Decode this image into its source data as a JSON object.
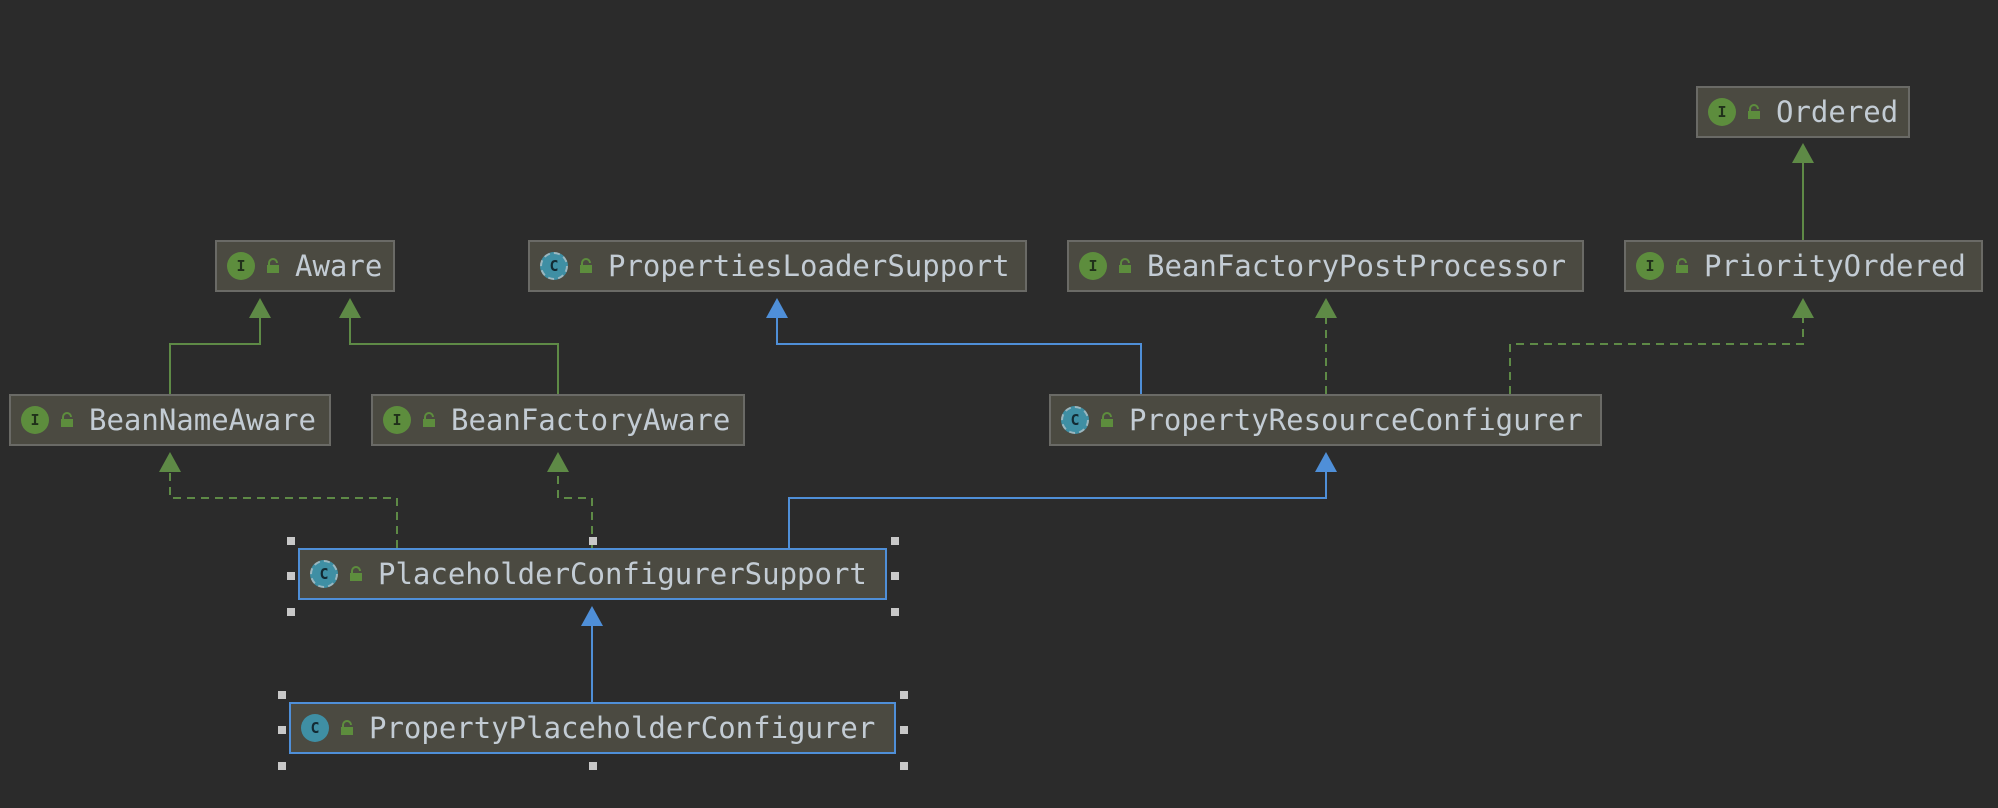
{
  "diagram": {
    "nodes": {
      "ordered": {
        "label": "Ordered",
        "kind": "interface"
      },
      "aware": {
        "label": "Aware",
        "kind": "interface"
      },
      "properties_loader_support": {
        "label": "PropertiesLoaderSupport",
        "kind": "abstract-class"
      },
      "bean_factory_post_processor": {
        "label": "BeanFactoryPostProcessor",
        "kind": "interface"
      },
      "priority_ordered": {
        "label": "PriorityOrdered",
        "kind": "interface"
      },
      "bean_name_aware": {
        "label": "BeanNameAware",
        "kind": "interface"
      },
      "bean_factory_aware": {
        "label": "BeanFactoryAware",
        "kind": "interface"
      },
      "property_resource_configurer": {
        "label": "PropertyResourceConfigurer",
        "kind": "abstract-class"
      },
      "placeholder_configurer_support": {
        "label": "PlaceholderConfigurerSupport",
        "kind": "abstract-class",
        "selected": true
      },
      "property_placeholder_configurer": {
        "label": "PropertyPlaceholderConfigurer",
        "kind": "class",
        "selected": true
      }
    },
    "kind_letters": {
      "interface": "I",
      "class": "C",
      "abstract-class": "C"
    },
    "edges": [
      {
        "from": "priority_ordered",
        "to": "ordered",
        "type": "extends-interface"
      },
      {
        "from": "bean_name_aware",
        "to": "aware",
        "type": "extends-interface"
      },
      {
        "from": "bean_factory_aware",
        "to": "aware",
        "type": "extends-interface"
      },
      {
        "from": "property_resource_configurer",
        "to": "properties_loader_support",
        "type": "extends-class"
      },
      {
        "from": "property_resource_configurer",
        "to": "bean_factory_post_processor",
        "type": "implements"
      },
      {
        "from": "property_resource_configurer",
        "to": "priority_ordered",
        "type": "implements"
      },
      {
        "from": "placeholder_configurer_support",
        "to": "bean_name_aware",
        "type": "implements"
      },
      {
        "from": "placeholder_configurer_support",
        "to": "bean_factory_aware",
        "type": "implements"
      },
      {
        "from": "placeholder_configurer_support",
        "to": "property_resource_configurer",
        "type": "extends-class"
      },
      {
        "from": "property_placeholder_configurer",
        "to": "placeholder_configurer_support",
        "type": "extends-class"
      }
    ],
    "colors": {
      "background": "#2b2b2b",
      "interface_edge": "#5e8a46",
      "class_edge": "#4f8fd8",
      "node_fill": "#4b4a41",
      "node_border": "#6a6a66",
      "selected_border": "#4f8fd8",
      "text": "#c3ccd4"
    }
  }
}
